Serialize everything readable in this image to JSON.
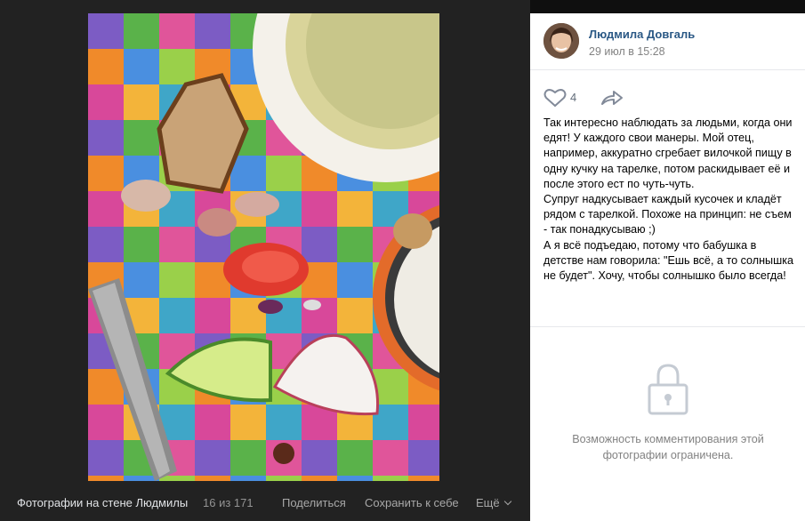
{
  "author": {
    "name": "Людмила Довгаль",
    "date": "29 июл в 15:28"
  },
  "actions": {
    "likes": "4"
  },
  "post": {
    "text": "Так интересно наблюдать за людьми, когда они едят! У каждого свои манеры. Мой отец, например, аккуратно сгребает вилочкой пищу в одну кучку на тарелке, потом раскидывает её и после этого ест по чуть-чуть.\nСупруг надкусывает каждый кусочек и кладёт рядом с тарелкой. Похоже на принцип: не съем - так понадкусываю ;)\nА я всё подъедаю, потому что бабушка в детстве нам говорила: \"Ешь всё, а то солнышка не будет\". Хочу, чтобы солнышко было всегда!"
  },
  "comments": {
    "restricted": "Возможность комментирования этой фотографии ограничена."
  },
  "bottom_bar": {
    "album": "Фотографии на стене Людмилы",
    "counter": "16 из 171",
    "share": "Поделиться",
    "save": "Сохранить к себе",
    "more": "Ещё"
  },
  "colors": {
    "link": "#2a5885",
    "muted": "#828282",
    "dark_bg": "#222222"
  }
}
